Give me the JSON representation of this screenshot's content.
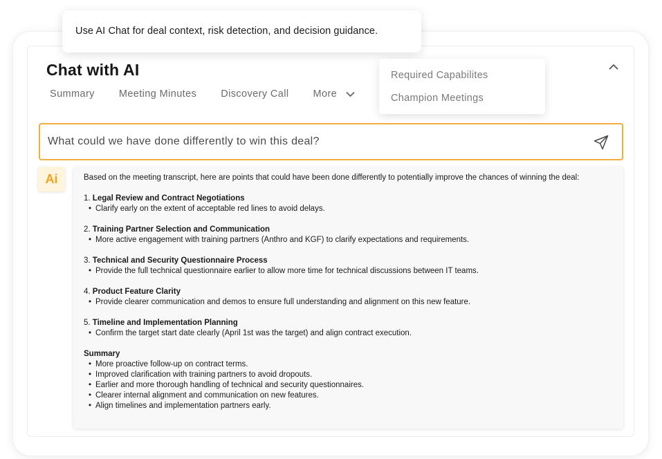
{
  "tooltip": {
    "text": "Use AI Chat for deal context, risk detection, and decision guidance."
  },
  "header": {
    "title": "Chat with AI",
    "collapse_icon": "chevron-up-icon"
  },
  "tabs": [
    {
      "label": "Summary"
    },
    {
      "label": "Meeting Minutes"
    },
    {
      "label": "Discovery Call"
    },
    {
      "label": "More"
    }
  ],
  "dropdown": {
    "items": [
      {
        "label": "Required Capabilites"
      },
      {
        "label": "Champion Meetings"
      }
    ]
  },
  "search": {
    "value": "What could we have done differently to win this deal?",
    "send_icon": "send-icon"
  },
  "avatar": {
    "label": "Ai"
  },
  "response": {
    "intro": "Based on the meeting transcript, here are points that could have been done differently to potentially improve the chances of winning the deal:",
    "sections": [
      {
        "num": "1.",
        "title": "Legal Review and Contract Negotiations",
        "bullet": "Clarify early on the extent of acceptable red lines to avoid delays."
      },
      {
        "num": "2.",
        "title": "Training Partner Selection and Communication",
        "bullet": "More active engagement with training partners (Anthro and KGF) to clarify expectations and requirements."
      },
      {
        "num": "3.",
        "title": "Technical and Security Questionnaire Process",
        "bullet": "Provide the full technical questionnaire earlier to allow more time for technical discussions between IT teams."
      },
      {
        "num": "4.",
        "title": "Product Feature Clarity",
        "bullet": "Provide clearer communication and demos to ensure full understanding and alignment on this new feature."
      },
      {
        "num": "5.",
        "title": "Timeline and Implementation Planning",
        "bullet": "Confirm the target start date clearly (April 1st was the target) and align contract execution."
      }
    ],
    "summary_title": "Summary",
    "summary_bullets": [
      "More proactive follow-up on contract terms.",
      "Improved clarification with training partners to avoid dropouts.",
      "Earlier and more thorough handling of technical and security questionnaires.",
      "Clearer internal alignment and communication on new features.",
      "Align timelines and implementation partners early."
    ]
  },
  "colors": {
    "accent": "#f4ae3d",
    "avatar_bg": "#fff4dc",
    "avatar_text": "#f4a21e"
  }
}
